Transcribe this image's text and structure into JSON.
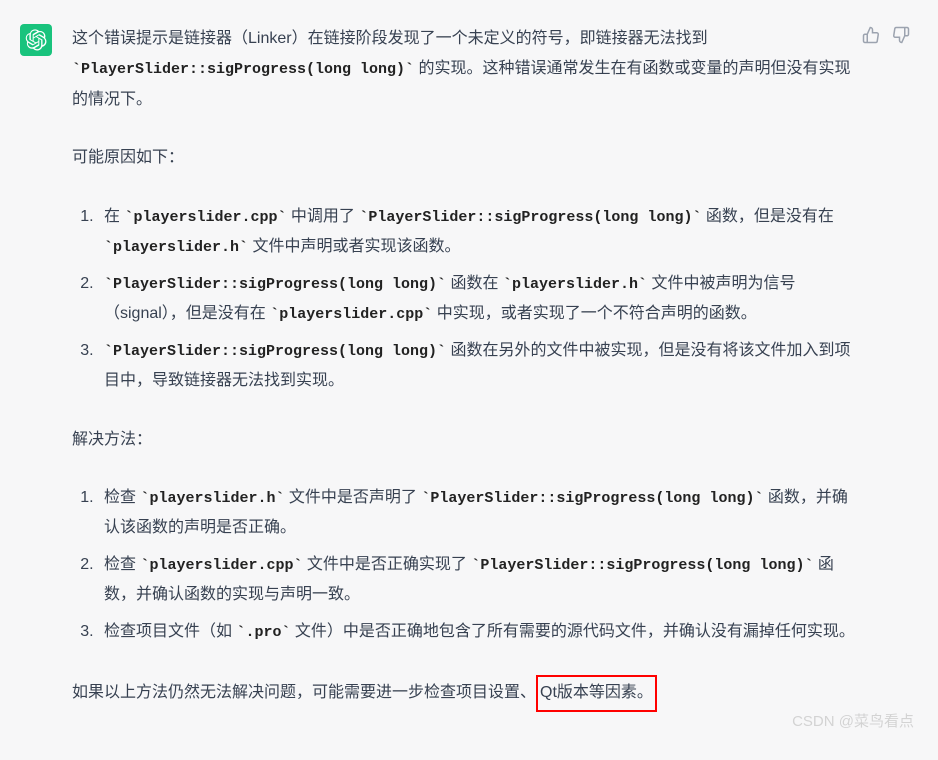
{
  "intro": {
    "part1": "这个错误提示是链接器（Linker）在链接阶段发现了一个未定义的符号，即链接器无法找到 ",
    "code1": "`PlayerSlider::sigProgress(long long)`",
    "part2": " 的实现。这种错误通常发生在有函数或变量的声明但没有实现的情况下。"
  },
  "causesLabel": "可能原因如下：",
  "causes": [
    {
      "t1": "在 ",
      "c1": "`playerslider.cpp`",
      "t2": " 中调用了 ",
      "c2": "`PlayerSlider::sigProgress(long long)`",
      "t3": " 函数，但是没有在 ",
      "c3": "`playerslider.h`",
      "t4": " 文件中声明或者实现该函数。"
    },
    {
      "c1": "`PlayerSlider::sigProgress(long long)`",
      "t1": " 函数在 ",
      "c2": "`playerslider.h`",
      "t2": " 文件中被声明为信号（signal），但是没有在 ",
      "c3": "`playerslider.cpp`",
      "t3": " 中实现，或者实现了一个不符合声明的函数。"
    },
    {
      "c1": "`PlayerSlider::sigProgress(long long)`",
      "t1": " 函数在另外的文件中被实现，但是没有将该文件加入到项目中，导致链接器无法找到实现。"
    }
  ],
  "solutionsLabel": "解决方法：",
  "solutions": [
    {
      "t1": "检查 ",
      "c1": "`playerslider.h`",
      "t2": " 文件中是否声明了 ",
      "c2": "`PlayerSlider::sigProgress(long long)`",
      "t3": " 函数，并确认该函数的声明是否正确。"
    },
    {
      "t1": "检查 ",
      "c1": "`playerslider.cpp`",
      "t2": " 文件中是否正确实现了 ",
      "c2": "`PlayerSlider::sigProgress(long long)`",
      "t3": " 函数，并确认函数的实现与声明一致。"
    },
    {
      "t1": "检查项目文件（如 ",
      "c1": "`.pro`",
      "t2": " 文件）中是否正确地包含了所有需要的源代码文件，并确认没有漏掉任何实现。"
    }
  ],
  "closing": {
    "part1": "如果以上方法仍然无法解决问题，可能需要进一步检查项目设置、",
    "highlighted": "Qt版本等因素。"
  },
  "watermark": "CSDN @菜鸟看点"
}
